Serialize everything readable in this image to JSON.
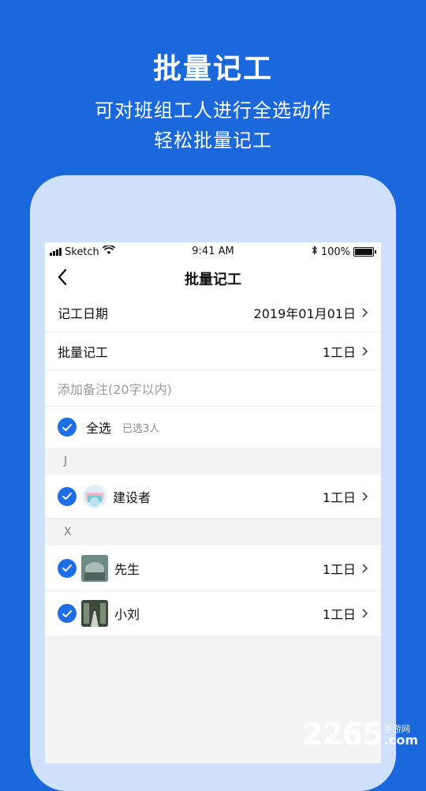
{
  "promo": {
    "title": "批量记工",
    "subtitle_line1": "可对班组工人进行全选动作",
    "subtitle_line2": "轻松批量记工"
  },
  "status_bar": {
    "carrier": "Sketch",
    "time": "9:41 AM",
    "battery": "100%"
  },
  "nav": {
    "title": "批量记工",
    "back_icon": "chevron-left-icon"
  },
  "form": {
    "date_label": "记工日期",
    "date_value": "2019年01月01日",
    "batch_label": "批量记工",
    "batch_value": "1工日",
    "note_placeholder": "添加备注(20字以内)"
  },
  "select_all": {
    "label": "全选",
    "count": "已选3人"
  },
  "sections": [
    {
      "header": "J",
      "workers": [
        {
          "name": "建设者",
          "value": "1工日"
        }
      ]
    },
    {
      "header": "X",
      "workers": [
        {
          "name": "先生",
          "value": "1工日"
        },
        {
          "name": "小刘",
          "value": "1工日"
        }
      ]
    }
  ],
  "watermark": {
    "number": "2265",
    "site": "手游网",
    "domain": ".com"
  },
  "colors": {
    "background": "#1b68dc",
    "phone_frame": "#cfe0fa",
    "check": "#1e6ee8"
  }
}
